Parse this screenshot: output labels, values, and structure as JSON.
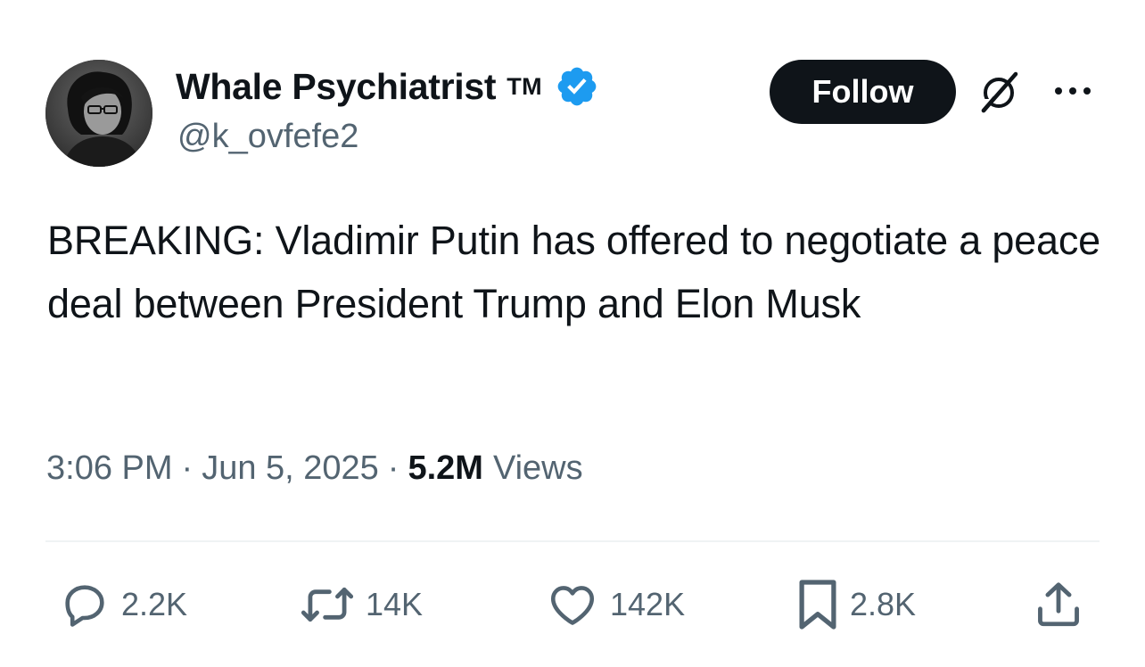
{
  "author": {
    "display_name": "Whale Psychiatrist",
    "tm_mark": "TM",
    "handle": "@k_ovfefe2",
    "verified": true,
    "verified_color": "#1d9bf0"
  },
  "header_actions": {
    "follow_label": "Follow",
    "grok_icon": "grok-icon",
    "more_icon": "more-icon"
  },
  "tweet": {
    "text": "BREAKING: Vladimir Putin has offered to negotiate a peace deal between President Trump and Elon Musk",
    "time": "3:06 PM",
    "separator": "·",
    "date": "Jun 5, 2025",
    "views_count": "5.2M",
    "views_label": "Views"
  },
  "engagement": {
    "replies": "2.2K",
    "reposts": "14K",
    "likes": "142K",
    "bookmarks": "2.8K"
  },
  "colors": {
    "text_primary": "#0f1419",
    "text_secondary": "#536471",
    "divider": "#eff3f4",
    "follow_button_bg": "#0f1419"
  }
}
